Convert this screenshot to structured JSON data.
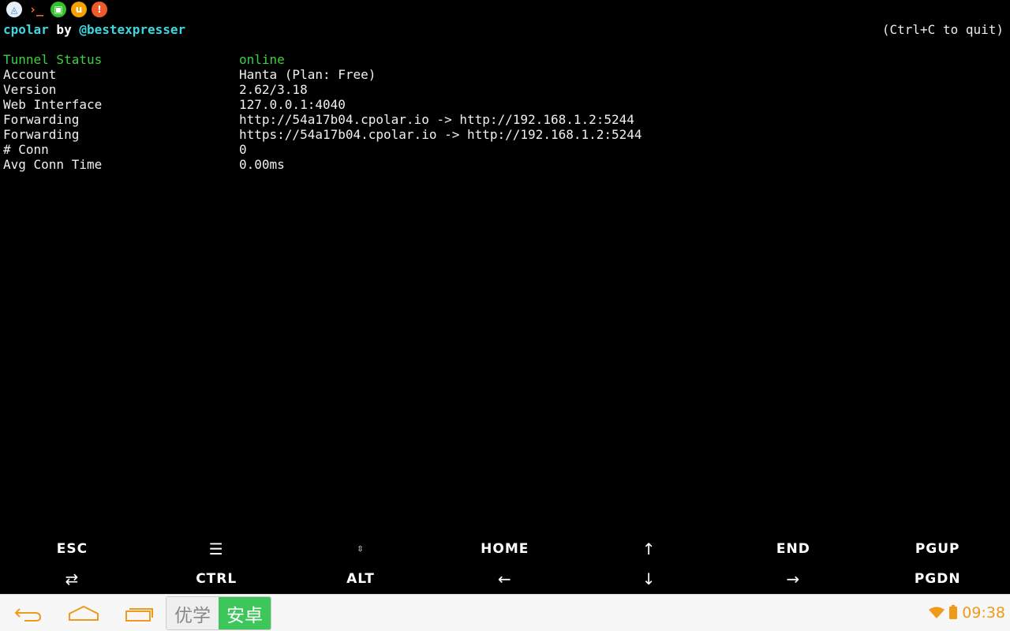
{
  "status_bar": {
    "icons": [
      {
        "name": "app-triangle-icon",
        "glyph": "◬",
        "color": "#2a7fd4"
      },
      {
        "name": "terminal-icon",
        "glyph": "›_",
        "color": "#ff7a2a"
      },
      {
        "name": "screenshot-icon",
        "glyph": "▣",
        "color": "#35c02d"
      },
      {
        "name": "u-app-icon",
        "glyph": "u",
        "color": "#f5a100"
      },
      {
        "name": "warning-icon",
        "glyph": "!",
        "color": "#f05a2a"
      }
    ]
  },
  "terminal": {
    "brand": "cpolar",
    "by": " by ",
    "author": "@bestexpresser",
    "quit_hint": "(Ctrl+C to quit)",
    "rows": [
      {
        "key": "Tunnel Status",
        "value": "online",
        "highlight": true
      },
      {
        "key": "Account",
        "value": "Hanta (Plan: Free)"
      },
      {
        "key": "Version",
        "value": "2.62/3.18"
      },
      {
        "key": "Web Interface",
        "value": "127.0.0.1:4040"
      },
      {
        "key": "Forwarding",
        "value": "http://54a17b04.cpolar.io -> http://192.168.1.2:5244"
      },
      {
        "key": "Forwarding",
        "value": "https://54a17b04.cpolar.io -> http://192.168.1.2:5244"
      },
      {
        "key": "# Conn",
        "value": "0"
      },
      {
        "key": "Avg Conn Time",
        "value": "0.00ms"
      }
    ],
    "colors": {
      "accent": "#3fd6de",
      "status": "#3cd23c",
      "text": "#f0f0f0",
      "background": "#000000"
    }
  },
  "extra_keys": {
    "row1": [
      "ESC",
      "☰",
      "⇳",
      "HOME",
      "↑",
      "END",
      "PGUP"
    ],
    "row2": [
      "⇄",
      "CTRL",
      "ALT",
      "←",
      "↓",
      "→",
      "PGDN"
    ]
  },
  "navbar": {
    "ime_left": "优学",
    "ime_right": "安卓",
    "clock": "09:38",
    "colors": {
      "tray": "#f09a1a",
      "ime_active": "#3dc65a"
    }
  }
}
